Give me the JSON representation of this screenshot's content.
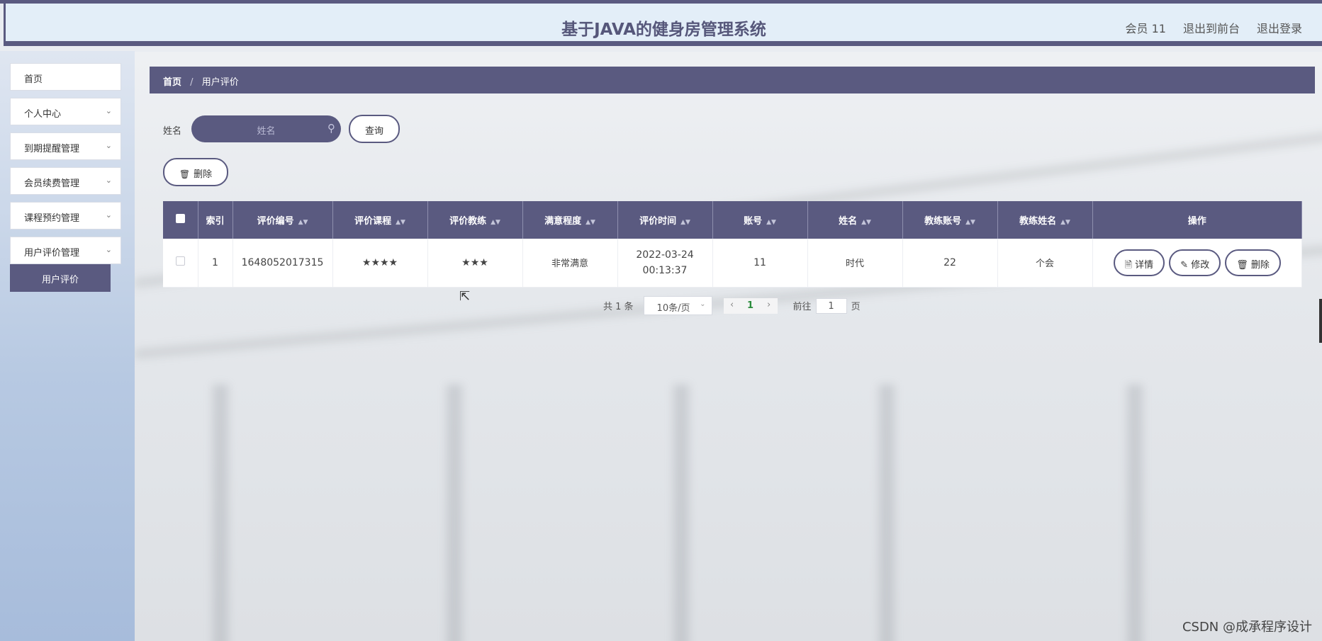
{
  "header": {
    "title": "基于JAVA的健身房管理系统",
    "nav": [
      "会员 11",
      "退出到前台",
      "退出登录"
    ]
  },
  "sidebar": {
    "items": [
      {
        "label": "首页",
        "has_children": false
      },
      {
        "label": "个人中心",
        "has_children": true
      },
      {
        "label": "到期提醒管理",
        "has_children": true
      },
      {
        "label": "会员续费管理",
        "has_children": true
      },
      {
        "label": "课程预约管理",
        "has_children": true
      },
      {
        "label": "用户评价管理",
        "has_children": true
      }
    ],
    "active_sub": "用户评价"
  },
  "breadcrumb": {
    "home": "首页",
    "separator": "/",
    "current": "用户评价"
  },
  "search": {
    "label": "姓名",
    "placeholder": "姓名",
    "query_button": "查询"
  },
  "toolbar": {
    "delete_label": "删除"
  },
  "table": {
    "columns": [
      "索引",
      "评价编号",
      "评价课程",
      "评价教练",
      "满意程度",
      "评价时间",
      "账号",
      "姓名",
      "教练账号",
      "教练姓名",
      "操作"
    ],
    "rows": [
      {
        "index": "1",
        "review_no": "1648052017315",
        "course_rating": "★★★★",
        "coach_rating": "★★★",
        "satisfaction": "非常满意",
        "time": "2022-03-24 00:13:37",
        "account": "11",
        "name": "时代",
        "coach_account": "22",
        "coach_name": "个会"
      }
    ],
    "actions": [
      "详情",
      "修改",
      "删除"
    ]
  },
  "pagination": {
    "total_text": "共 1 条",
    "page_size": "10条/页",
    "current_page": "1",
    "goto_label": "前往",
    "goto_value": "1",
    "page_suffix": "页"
  },
  "watermark": "CSDN @成承程序设计",
  "colors": {
    "primary": "#5a5a80",
    "header_bg": "#e3eef8"
  }
}
